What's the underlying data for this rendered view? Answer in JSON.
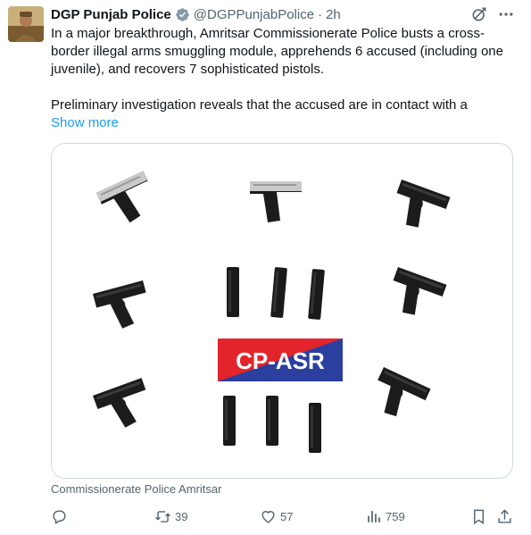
{
  "post": {
    "author_name": "DGP Punjab Police",
    "handle": "@DGPPunjabPolice",
    "separator": "·",
    "time": "2h",
    "text_para1": "In a major breakthrough, Amritsar Commissionerate Police busts a cross-border illegal arms smuggling module, apprehends 6 accused (including one juvenile), and recovers 7 sophisticated pistols.",
    "text_para2": "Preliminary investigation reveals that the accused are in contact with a",
    "show_more": "Show more",
    "media_badge": "CP-ASR",
    "caption": "Commissionerate Police Amritsar"
  },
  "actions": {
    "reply_count": "",
    "retweet_count": "39",
    "like_count": "57",
    "views_count": "759"
  },
  "icons": {
    "verified": "verified-badge-icon",
    "grok": "grok-icon",
    "more": "more-icon",
    "reply": "reply-icon",
    "retweet": "retweet-icon",
    "like": "heart-icon",
    "views": "views-icon",
    "bookmark": "bookmark-icon",
    "share": "share-icon"
  },
  "colors": {
    "accent": "#1d9bf0",
    "text": "#0f1419",
    "muted": "#536471",
    "badge_red": "#e3242b",
    "badge_blue": "#2b3f9e"
  }
}
